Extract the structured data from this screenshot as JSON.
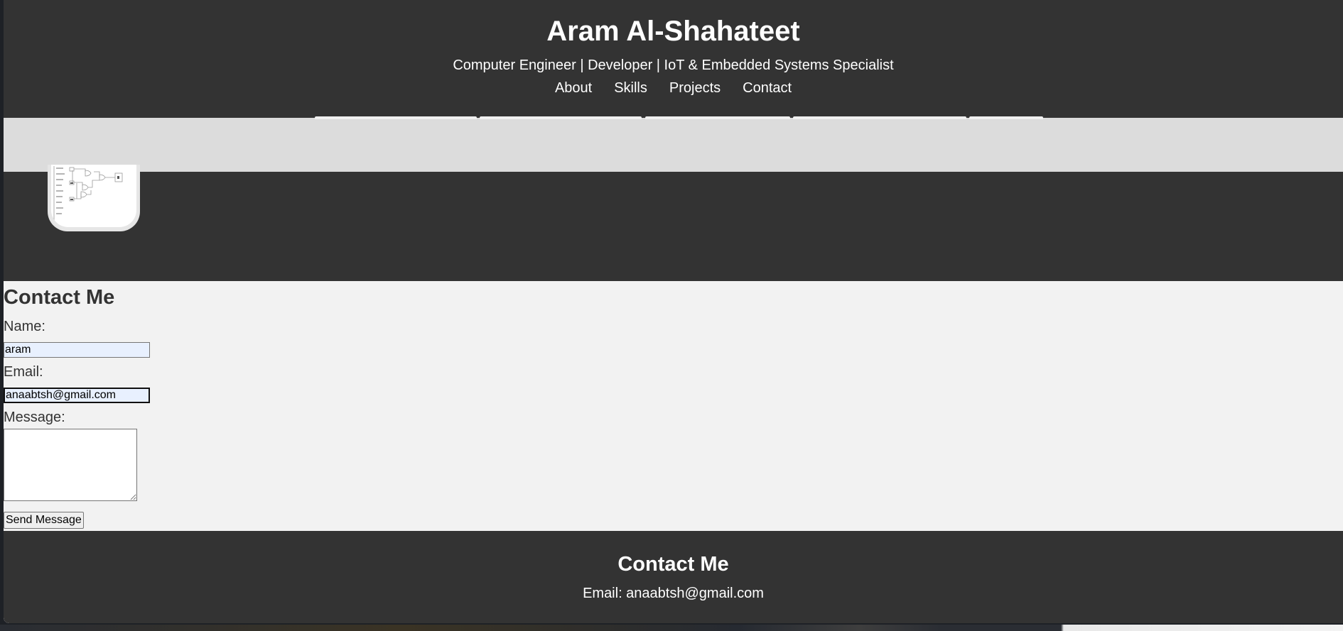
{
  "header": {
    "title": "Aram Al-Shahateet",
    "subtitle": "Computer Engineer | Developer | IoT & Embedded Systems Specialist",
    "nav": [
      "About",
      "Skills",
      "Projects",
      "Contact"
    ]
  },
  "contact": {
    "heading": "Contact Me",
    "name_label": "Name:",
    "name_value": "aram",
    "email_label": "Email:",
    "email_value": "anaabtsh@gmail.com",
    "message_label": "Message:",
    "message_value": "",
    "submit_label": "Send Message"
  },
  "footer": {
    "heading": "Contact Me",
    "email_text": "Email: anaabtsh@gmail.com"
  },
  "colors": {
    "header_bg": "#333333",
    "band_bg": "#dcdcdc",
    "page_bg": "#f2f2f2",
    "input_autofill_bg": "#e8f0fe",
    "text_light": "#ffffff",
    "text_dark": "#333333"
  },
  "icons": {
    "project_thumbnail": "logic-circuit-diagram-image"
  }
}
